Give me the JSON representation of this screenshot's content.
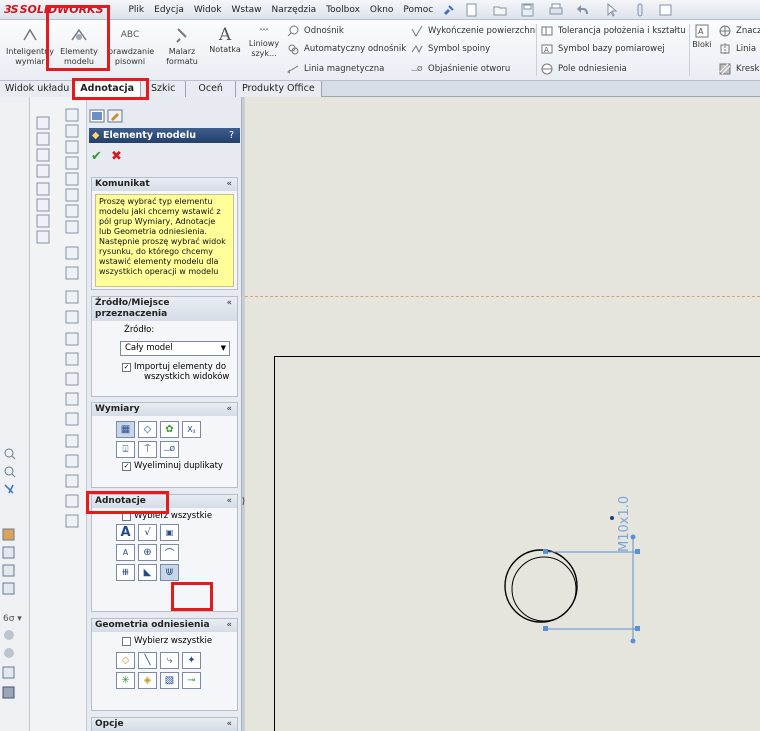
{
  "app": {
    "logo": {
      "ds": "3S",
      "solid": "SOLID",
      "works": "WORKS"
    },
    "menu": [
      "Plik",
      "Edycja",
      "Widok",
      "Wstaw",
      "Narzędzia",
      "Toolbox",
      "Okno",
      "Pomoc"
    ]
  },
  "ribbon": {
    "inteligentny": "Inteligentny wymiar",
    "elementy_line1": "Elementy",
    "elementy_line2": "modelu",
    "sprawdzanie_line1": "prawdzanie",
    "sprawdzanie_line2": "pisowni",
    "malarz_line1": "Malarz",
    "malarz_line2": "formatu",
    "notatka": "Notatka",
    "liniowy_line1": "Liniowy",
    "liniowy_line2": "szyk...",
    "odnosnik": "Odnośnik",
    "auto_odnosnik": "Automatyczny odnośnik",
    "linia_magnetyczna": "Linia magnetyczna",
    "wykonczenie": "Wykończenie powierzchni",
    "symbol_spoiny": "Symbol spoiny",
    "objasnienie": "Objaśnienie otworu",
    "tolerancja": "Tolerancja położenia i kształtu",
    "symbol_bazy": "Symbol bazy pomiarowej",
    "pole_odniesienia": "Pole odniesienia",
    "bloki": "Bloki",
    "znacznik": "Znacz",
    "linia": "Linia",
    "kreskowanie": "Kresk"
  },
  "tabs": [
    "Widok układu",
    "Adnotacja",
    "Szkic",
    "Oceń",
    "Produkty Office"
  ],
  "pm": {
    "title": "Elementy modelu",
    "help": "?",
    "komunikat": {
      "header": "Komunikat",
      "text": "Proszę wybrać typ elementu modelu jaki chcemy wstawić z pól grup Wymiary, Adnotacje lub Geometria odniesienia. Następnie proszę wybrać widok rysunku, do którego chcemy wstawić elementy modelu dla wszystkich operacji w modelu"
    },
    "zrodlo": {
      "header_line1": "Źródło/Miejsce",
      "header_line2": "przeznaczenia",
      "label": "Źródło:",
      "select_value": "Cały model",
      "import_line1": "Importuj elementy do",
      "import_line2": "wszystkich widoków"
    },
    "wymiary": {
      "header": "Wymiary",
      "eliminuj": "Wyeliminuj duplikaty"
    },
    "adnotacje": {
      "header": "Adnotacje",
      "wybierz": "Wybierz wszystkie"
    },
    "geometria": {
      "header": "Geometria odniesienia",
      "wybierz": "Wybierz wszystkie"
    },
    "opcje": {
      "header": "Opcje"
    }
  },
  "drawing": {
    "dimension_text": "M10x1.0"
  },
  "colors": {
    "highlight": "#e41b1b",
    "dimension": "#5b8fd6",
    "canvas": "#e6e5dd",
    "message_bg": "#fffe99"
  }
}
